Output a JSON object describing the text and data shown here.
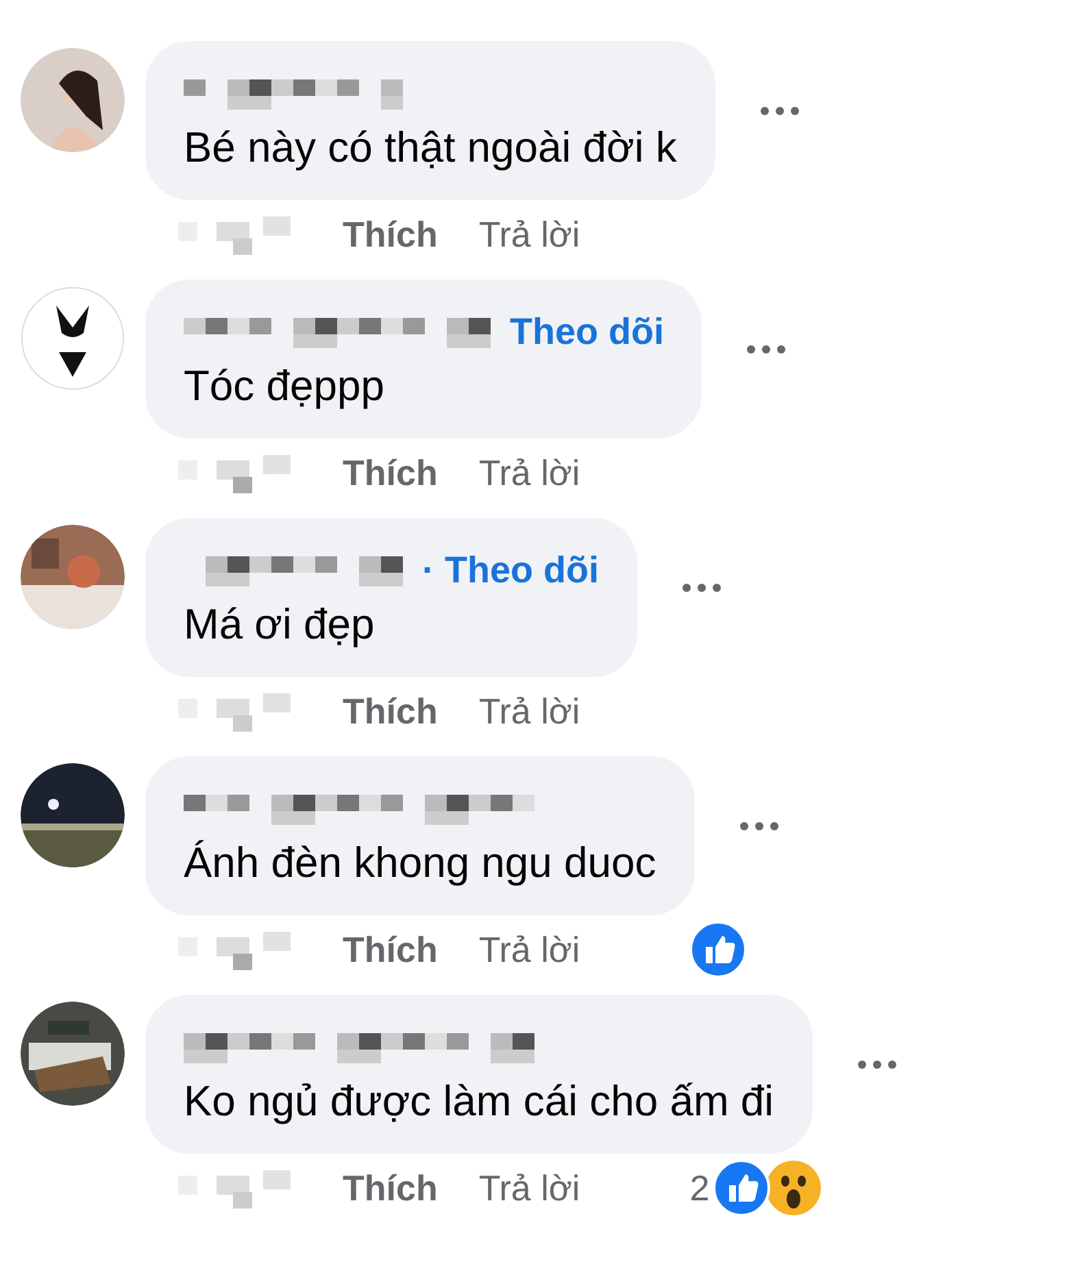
{
  "comments": [
    {
      "text": "Bé này có thật ngoài đời k",
      "actions": [
        "Thích",
        "Trả lời"
      ]
    },
    {
      "text": "Tóc đẹppp",
      "follow": "Theo dõi",
      "actions": [
        "Thích",
        "Trả lời"
      ]
    },
    {
      "text": "Má ơi đẹp",
      "follow": "· Theo dõi",
      "actions": [
        "Thích",
        "Trả lời"
      ]
    },
    {
      "text": "Ánh đèn khong ngu duoc",
      "actions": [
        "Thích",
        "Trả lời"
      ],
      "reactions": [
        {
          "kind": "like"
        }
      ]
    },
    {
      "text": "Ko ngủ được làm cái cho ấm đi",
      "actions": [
        "Thích",
        "Trả lời"
      ],
      "reaction_count": "2",
      "reactions": [
        {
          "kind": "like"
        },
        {
          "kind": "wow"
        }
      ]
    }
  ]
}
